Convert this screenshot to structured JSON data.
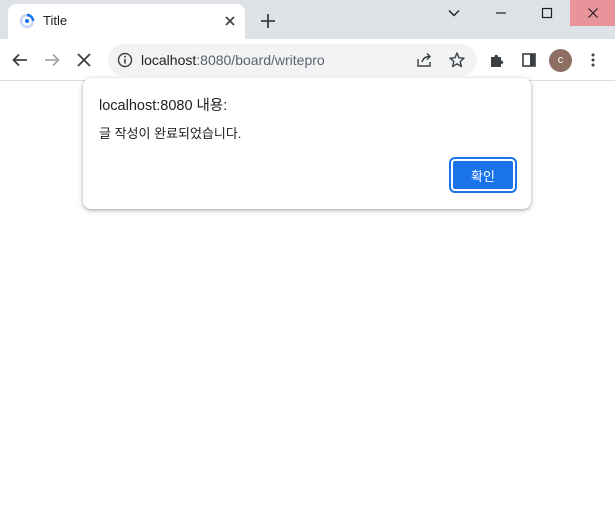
{
  "tab": {
    "title": "Title",
    "favicon": "spinner-favicon-icon",
    "close_icon": "close-icon"
  },
  "newtab": {
    "icon": "plus-icon"
  },
  "window_controls": {
    "chevron": "chevron-down-icon",
    "minimize": "minimize-icon",
    "maximize": "maximize-icon",
    "close": "close-icon",
    "close_color": "#e8949a"
  },
  "toolbar": {
    "back_icon": "back-arrow-icon",
    "forward_icon": "forward-arrow-icon",
    "stop_icon": "stop-loading-icon",
    "extensions_icon": "puzzle-icon",
    "sidepanel_icon": "side-panel-icon",
    "menu_icon": "kebab-menu-icon",
    "avatar_letter": "c",
    "avatar_color": "#8d6e63"
  },
  "omnibox": {
    "host": "localhost",
    "path": ":8080/board/writepro",
    "info_icon": "info-icon",
    "share_icon": "share-icon",
    "star_icon": "star-icon"
  },
  "dialog": {
    "title": "localhost:8080 내용:",
    "message": "글 작성이 완료되었습니다.",
    "ok_label": "확인",
    "ok_color": "#1a73e8"
  }
}
